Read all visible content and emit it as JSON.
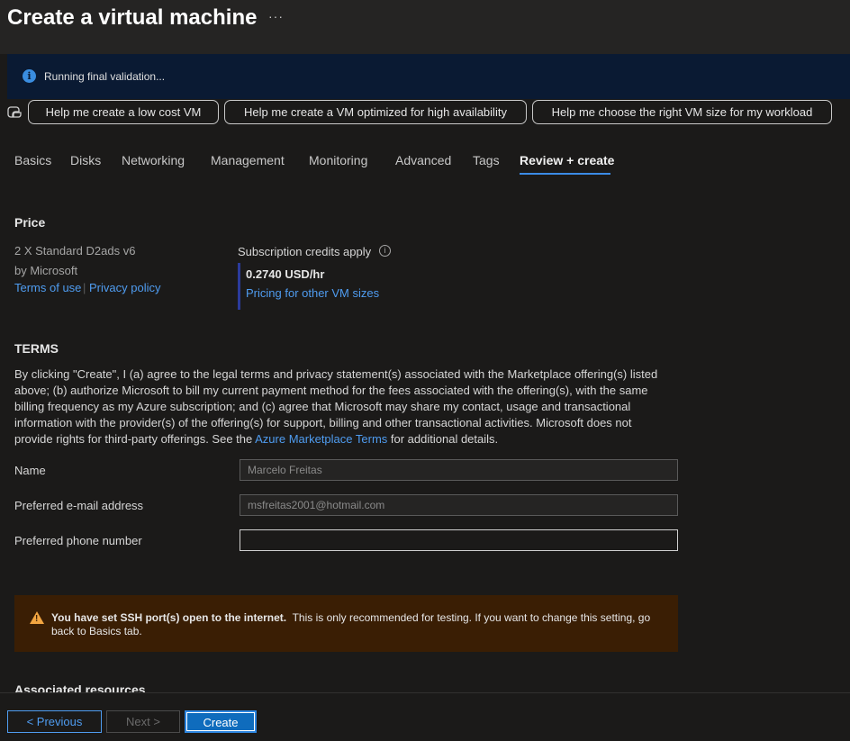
{
  "header": {
    "title": "Create a virtual machine",
    "more_label": "···"
  },
  "banner": {
    "icon": "info-icon",
    "text": "Running final validation..."
  },
  "copilot": {
    "icon": "copilot-icon",
    "suggestions": [
      "Help me create a low cost VM",
      "Help me create a VM optimized for high availability",
      "Help me choose the right VM size for my workload"
    ]
  },
  "tabs": [
    {
      "label": "Basics",
      "active": false
    },
    {
      "label": "Disks",
      "active": false
    },
    {
      "label": "Networking",
      "active": false
    },
    {
      "label": "Management",
      "active": false
    },
    {
      "label": "Monitoring",
      "active": false
    },
    {
      "label": "Advanced",
      "active": false
    },
    {
      "label": "Tags",
      "active": false
    },
    {
      "label": "Review + create",
      "active": true
    }
  ],
  "price": {
    "heading": "Price",
    "product": "2 X Standard D2ads v6",
    "publisher": "by Microsoft",
    "terms_link": "Terms of use",
    "separator": "|",
    "privacy_link": "Privacy policy",
    "credits_label": "Subscription credits apply",
    "rate": "0.2740 USD/hr",
    "pricing_link": "Pricing for other VM sizes"
  },
  "terms": {
    "heading": "TERMS",
    "body_before_link": "By clicking \"Create\", I (a) agree to the legal terms and privacy statement(s) associated with the Marketplace offering(s) listed above; (b) authorize Microsoft to bill my current payment method for the fees associated with the offering(s), with the same billing frequency as my Azure subscription; and (c) agree that Microsoft may share my contact, usage and transactional information with the provider(s) of the offering(s) for support, billing and other transactional activities. Microsoft does not provide rights for third-party offerings. See the ",
    "link": "Azure Marketplace Terms",
    "body_after_link": " for additional details."
  },
  "form": {
    "name_label": "Name",
    "name_value": "Marcelo Freitas",
    "email_label": "Preferred e-mail address",
    "email_value": "msfreitas2001@hotmail.com",
    "phone_label": "Preferred phone number",
    "phone_value": ""
  },
  "warning": {
    "icon": "warning-icon",
    "bold": "You have set SSH port(s) open to the internet.",
    "text": "This is only recommended for testing.  If you want to change this setting, go back to Basics tab."
  },
  "associated": {
    "heading": "Associated resources"
  },
  "footer": {
    "previous": "< Previous",
    "next": "Next >",
    "create": "Create"
  },
  "colors": {
    "background": "#1b1a19",
    "accent": "#0f6cbd",
    "link": "#4f9cf0",
    "warning": "#f2a541"
  }
}
